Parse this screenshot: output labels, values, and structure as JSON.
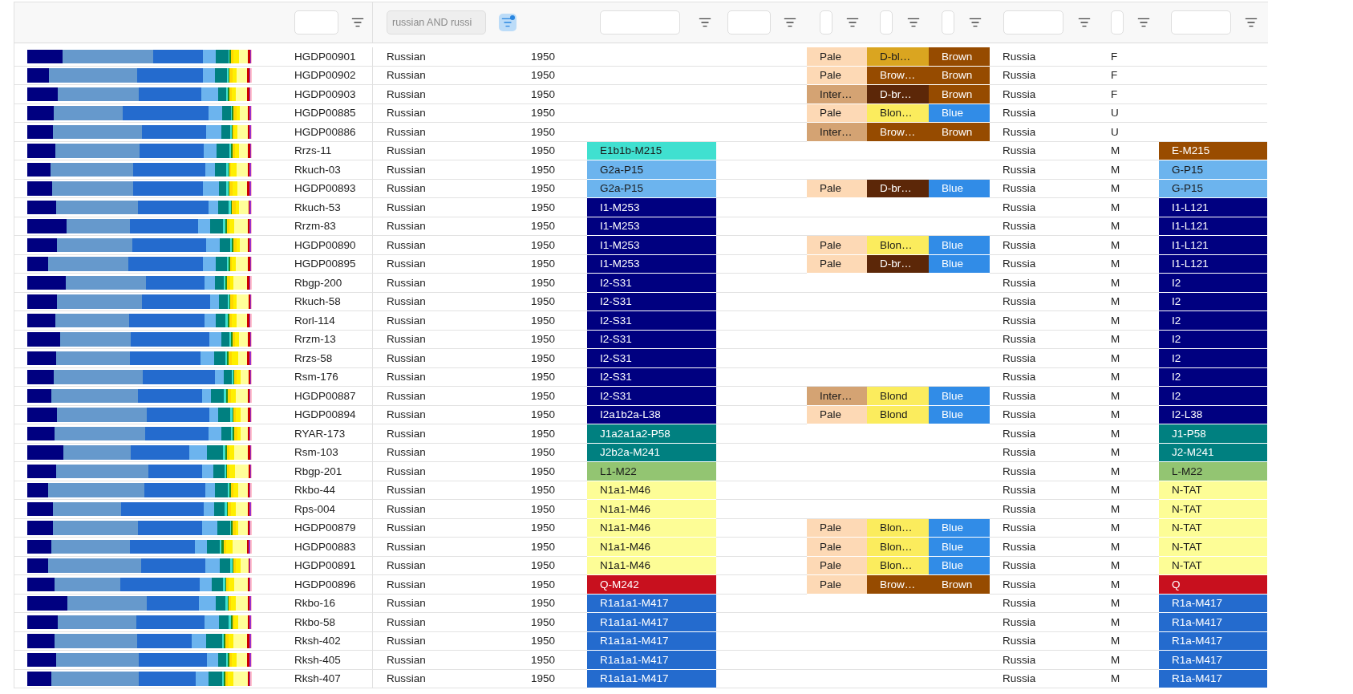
{
  "columns": [
    {
      "filter_field": false
    },
    {
      "filter_field": true,
      "disabled": false,
      "active": false
    },
    {
      "filter_field": true,
      "disabled": true,
      "active": true,
      "value": "russian AND russi"
    },
    {
      "filter_field": false
    },
    {
      "filter_field": true,
      "disabled": false,
      "active": false
    },
    {
      "filter_field": true,
      "disabled": false,
      "active": false
    },
    {
      "filter_field": true,
      "disabled": false,
      "active": false
    },
    {
      "filter_field": true,
      "disabled": false,
      "active": false
    },
    {
      "filter_field": true,
      "disabled": false,
      "active": false
    },
    {
      "filter_field": true,
      "disabled": false,
      "active": false
    },
    {
      "filter_field": true,
      "disabled": false,
      "active": false
    },
    {
      "filter_field": true,
      "disabled": false,
      "active": false
    }
  ],
  "rows": [
    {
      "id": "HGDP00901",
      "population": "Russian",
      "date": "1950",
      "skin": {
        "text": "Pale",
        "color": "#fdd9b5"
      },
      "hair": {
        "text": "D-bl…",
        "color": "#daa520"
      },
      "eye": {
        "text": "Brown",
        "color": "#964b00"
      },
      "country": "Russia",
      "sex": "F"
    },
    {
      "id": "HGDP00902",
      "population": "Russian",
      "date": "1950",
      "skin": {
        "text": "Pale",
        "color": "#fdd9b5"
      },
      "hair": {
        "text": "Brow…",
        "color": "#964b00"
      },
      "eye": {
        "text": "Brown",
        "color": "#964b00"
      },
      "country": "Russia",
      "sex": "F"
    },
    {
      "id": "HGDP00903",
      "population": "Russian",
      "date": "1950",
      "skin": {
        "text": "Inter…",
        "color": "#d4a373"
      },
      "hair": {
        "text": "D-br…",
        "color": "#5c2708"
      },
      "eye": {
        "text": "Brown",
        "color": "#964b00"
      },
      "country": "Russia",
      "sex": "F"
    },
    {
      "id": "HGDP00885",
      "population": "Russian",
      "date": "1950",
      "skin": {
        "text": "Pale",
        "color": "#fdd9b5"
      },
      "hair": {
        "text": "Blon…",
        "color": "#fbec5d"
      },
      "eye": {
        "text": "Blue",
        "color": "#318ce7"
      },
      "country": "Russia",
      "sex": "U"
    },
    {
      "id": "HGDP00886",
      "population": "Russian",
      "date": "1950",
      "skin": {
        "text": "Inter…",
        "color": "#d4a373"
      },
      "hair": {
        "text": "Brow…",
        "color": "#964b00"
      },
      "eye": {
        "text": "Brown",
        "color": "#964b00"
      },
      "country": "Russia",
      "sex": "U"
    },
    {
      "id": "Rrzs-11",
      "population": "Russian",
      "date": "1950",
      "y_haplogroup": {
        "text": "E1b1b-M215",
        "color": "#40e0d0"
      },
      "country": "Russia",
      "sex": "M",
      "y_short": {
        "text": "E-M215",
        "color": "#994c00"
      }
    },
    {
      "id": "Rkuch-03",
      "population": "Russian",
      "date": "1950",
      "y_haplogroup": {
        "text": "G2a-P15",
        "color": "#6cb4ee"
      },
      "country": "Russia",
      "sex": "M",
      "y_short": {
        "text": "G-P15",
        "color": "#6cb4ee"
      }
    },
    {
      "id": "HGDP00893",
      "population": "Russian",
      "date": "1950",
      "y_haplogroup": {
        "text": "G2a-P15",
        "color": "#6cb4ee"
      },
      "skin": {
        "text": "Pale",
        "color": "#fdd9b5"
      },
      "hair": {
        "text": "D-br…",
        "color": "#5c2708"
      },
      "eye": {
        "text": "Blue",
        "color": "#318ce7"
      },
      "country": "Russia",
      "sex": "M",
      "y_short": {
        "text": "G-P15",
        "color": "#6cb4ee"
      }
    },
    {
      "id": "Rkuch-53",
      "population": "Russian",
      "date": "1950",
      "y_haplogroup": {
        "text": "I1-M253",
        "color": "#000080"
      },
      "country": "Russia",
      "sex": "M",
      "y_short": {
        "text": "I1-L121",
        "color": "#000080"
      }
    },
    {
      "id": "Rrzm-83",
      "population": "Russian",
      "date": "1950",
      "y_haplogroup": {
        "text": "I1-M253",
        "color": "#000080"
      },
      "country": "Russia",
      "sex": "M",
      "y_short": {
        "text": "I1-L121",
        "color": "#000080"
      }
    },
    {
      "id": "HGDP00890",
      "population": "Russian",
      "date": "1950",
      "y_haplogroup": {
        "text": "I1-M253",
        "color": "#000080"
      },
      "skin": {
        "text": "Pale",
        "color": "#fdd9b5"
      },
      "hair": {
        "text": "Blon…",
        "color": "#fbec5d"
      },
      "eye": {
        "text": "Blue",
        "color": "#318ce7"
      },
      "country": "Russia",
      "sex": "M",
      "y_short": {
        "text": "I1-L121",
        "color": "#000080"
      }
    },
    {
      "id": "HGDP00895",
      "population": "Russian",
      "date": "1950",
      "y_haplogroup": {
        "text": "I1-M253",
        "color": "#000080"
      },
      "skin": {
        "text": "Pale",
        "color": "#fdd9b5"
      },
      "hair": {
        "text": "D-br…",
        "color": "#5c2708"
      },
      "eye": {
        "text": "Blue",
        "color": "#318ce7"
      },
      "country": "Russia",
      "sex": "M",
      "y_short": {
        "text": "I1-L121",
        "color": "#000080"
      }
    },
    {
      "id": "Rbgp-200",
      "population": "Russian",
      "date": "1950",
      "y_haplogroup": {
        "text": "I2-S31",
        "color": "#000080"
      },
      "country": "Russia",
      "sex": "M",
      "y_short": {
        "text": "I2",
        "color": "#000080"
      }
    },
    {
      "id": "Rkuch-58",
      "population": "Russian",
      "date": "1950",
      "y_haplogroup": {
        "text": "I2-S31",
        "color": "#000080"
      },
      "country": "Russia",
      "sex": "M",
      "y_short": {
        "text": "I2",
        "color": "#000080"
      }
    },
    {
      "id": "Rorl-114",
      "population": "Russian",
      "date": "1950",
      "y_haplogroup": {
        "text": "I2-S31",
        "color": "#000080"
      },
      "country": "Russia",
      "sex": "M",
      "y_short": {
        "text": "I2",
        "color": "#000080"
      }
    },
    {
      "id": "Rrzm-13",
      "population": "Russian",
      "date": "1950",
      "y_haplogroup": {
        "text": "I2-S31",
        "color": "#000080"
      },
      "country": "Russia",
      "sex": "M",
      "y_short": {
        "text": "I2",
        "color": "#000080"
      }
    },
    {
      "id": "Rrzs-58",
      "population": "Russian",
      "date": "1950",
      "y_haplogroup": {
        "text": "I2-S31",
        "color": "#000080"
      },
      "country": "Russia",
      "sex": "M",
      "y_short": {
        "text": "I2",
        "color": "#000080"
      }
    },
    {
      "id": "Rsm-176",
      "population": "Russian",
      "date": "1950",
      "y_haplogroup": {
        "text": "I2-S31",
        "color": "#000080"
      },
      "country": "Russia",
      "sex": "M",
      "y_short": {
        "text": "I2",
        "color": "#000080"
      }
    },
    {
      "id": "HGDP00887",
      "population": "Russian",
      "date": "1950",
      "y_haplogroup": {
        "text": "I2-S31",
        "color": "#000080"
      },
      "skin": {
        "text": "Inter…",
        "color": "#d4a373"
      },
      "hair": {
        "text": "Blond",
        "color": "#fbec5d"
      },
      "eye": {
        "text": "Blue",
        "color": "#318ce7"
      },
      "country": "Russia",
      "sex": "M",
      "y_short": {
        "text": "I2",
        "color": "#000080"
      }
    },
    {
      "id": "HGDP00894",
      "population": "Russian",
      "date": "1950",
      "y_haplogroup": {
        "text": "I2a1b2a-L38",
        "color": "#000080"
      },
      "skin": {
        "text": "Pale",
        "color": "#fdd9b5"
      },
      "hair": {
        "text": "Blond",
        "color": "#fbec5d"
      },
      "eye": {
        "text": "Blue",
        "color": "#318ce7"
      },
      "country": "Russia",
      "sex": "M",
      "y_short": {
        "text": "I2-L38",
        "color": "#000080"
      }
    },
    {
      "id": "RYAR-173",
      "population": "Russian",
      "date": "1950",
      "y_haplogroup": {
        "text": "J1a2a1a2-P58",
        "color": "#008080"
      },
      "country": "Russia",
      "sex": "M",
      "y_short": {
        "text": "J1-P58",
        "color": "#008080"
      }
    },
    {
      "id": "Rsm-103",
      "population": "Russian",
      "date": "1950",
      "y_haplogroup": {
        "text": "J2b2a-M241",
        "color": "#008080"
      },
      "country": "Russia",
      "sex": "M",
      "y_short": {
        "text": "J2-M241",
        "color": "#008080"
      }
    },
    {
      "id": "Rbgp-201",
      "population": "Russian",
      "date": "1950",
      "y_haplogroup": {
        "text": "L1-M22",
        "color": "#93c572"
      },
      "country": "Russia",
      "sex": "M",
      "y_short": {
        "text": "L-M22",
        "color": "#93c572"
      }
    },
    {
      "id": "Rkbo-44",
      "population": "Russian",
      "date": "1950",
      "y_haplogroup": {
        "text": "N1a1-M46",
        "color": "#fdfd96"
      },
      "country": "Russia",
      "sex": "M",
      "y_short": {
        "text": "N-TAT",
        "color": "#fdfd96"
      }
    },
    {
      "id": "Rps-004",
      "population": "Russian",
      "date": "1950",
      "y_haplogroup": {
        "text": "N1a1-M46",
        "color": "#fdfd96"
      },
      "country": "Russia",
      "sex": "M",
      "y_short": {
        "text": "N-TAT",
        "color": "#fdfd96"
      }
    },
    {
      "id": "HGDP00879",
      "population": "Russian",
      "date": "1950",
      "y_haplogroup": {
        "text": "N1a1-M46",
        "color": "#fdfd96"
      },
      "skin": {
        "text": "Pale",
        "color": "#fdd9b5"
      },
      "hair": {
        "text": "Blon…",
        "color": "#fbec5d"
      },
      "eye": {
        "text": "Blue",
        "color": "#318ce7"
      },
      "country": "Russia",
      "sex": "M",
      "y_short": {
        "text": "N-TAT",
        "color": "#fdfd96"
      }
    },
    {
      "id": "HGDP00883",
      "population": "Russian",
      "date": "1950",
      "y_haplogroup": {
        "text": "N1a1-M46",
        "color": "#fdfd96"
      },
      "skin": {
        "text": "Pale",
        "color": "#fdd9b5"
      },
      "hair": {
        "text": "Blon…",
        "color": "#fbec5d"
      },
      "eye": {
        "text": "Blue",
        "color": "#318ce7"
      },
      "country": "Russia",
      "sex": "M",
      "y_short": {
        "text": "N-TAT",
        "color": "#fdfd96"
      }
    },
    {
      "id": "HGDP00891",
      "population": "Russian",
      "date": "1950",
      "y_haplogroup": {
        "text": "N1a1-M46",
        "color": "#fdfd96"
      },
      "skin": {
        "text": "Pale",
        "color": "#fdd9b5"
      },
      "hair": {
        "text": "Blon…",
        "color": "#fbec5d"
      },
      "eye": {
        "text": "Blue",
        "color": "#318ce7"
      },
      "country": "Russia",
      "sex": "M",
      "y_short": {
        "text": "N-TAT",
        "color": "#fdfd96"
      }
    },
    {
      "id": "HGDP00896",
      "population": "Russian",
      "date": "1950",
      "y_haplogroup": {
        "text": "Q-M242",
        "color": "#c8101e"
      },
      "skin": {
        "text": "Pale",
        "color": "#fdd9b5"
      },
      "hair": {
        "text": "Brow…",
        "color": "#964b00"
      },
      "eye": {
        "text": "Brown",
        "color": "#964b00"
      },
      "country": "Russia",
      "sex": "M",
      "y_short": {
        "text": "Q",
        "color": "#c8101e"
      }
    },
    {
      "id": "Rkbo-16",
      "population": "Russian",
      "date": "1950",
      "y_haplogroup": {
        "text": "R1a1a1-M417",
        "color": "#246bce"
      },
      "country": "Russia",
      "sex": "M",
      "y_short": {
        "text": "R1a-M417",
        "color": "#246bce"
      }
    },
    {
      "id": "Rkbo-58",
      "population": "Russian",
      "date": "1950",
      "y_haplogroup": {
        "text": "R1a1a1-M417",
        "color": "#246bce"
      },
      "country": "Russia",
      "sex": "M",
      "y_short": {
        "text": "R1a-M417",
        "color": "#246bce"
      }
    },
    {
      "id": "Rksh-402",
      "population": "Russian",
      "date": "1950",
      "y_haplogroup": {
        "text": "R1a1a1-M417",
        "color": "#246bce"
      },
      "country": "Russia",
      "sex": "M",
      "y_short": {
        "text": "R1a-M417",
        "color": "#246bce"
      }
    },
    {
      "id": "Rksh-405",
      "population": "Russian",
      "date": "1950",
      "y_haplogroup": {
        "text": "R1a1a1-M417",
        "color": "#246bce"
      },
      "country": "Russia",
      "sex": "M",
      "y_short": {
        "text": "R1a-M417",
        "color": "#246bce"
      }
    },
    {
      "id": "Rksh-407",
      "population": "Russian",
      "date": "1950",
      "y_haplogroup": {
        "text": "R1a1a1-M417",
        "color": "#246bce"
      },
      "country": "Russia",
      "sex": "M",
      "y_short": {
        "text": "R1a-M417",
        "color": "#246bce"
      }
    }
  ]
}
